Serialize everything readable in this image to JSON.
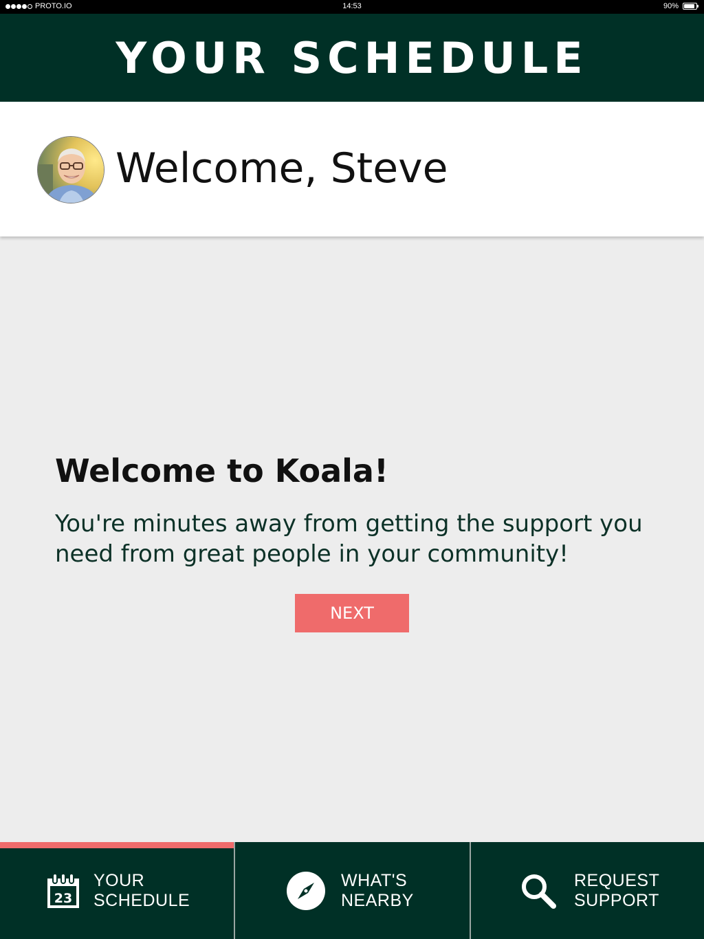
{
  "status_bar": {
    "carrier": "PROTO.IO",
    "time": "14:53",
    "battery_percent_text": "90%",
    "battery_level": 0.9
  },
  "header": {
    "title": "YOUR SCHEDULE"
  },
  "welcome": {
    "greeting": "Welcome, Steve"
  },
  "onboarding": {
    "heading": "Welcome to Koala!",
    "body": "You're minutes away from getting the support you need from great people in your community!",
    "next_label": "NEXT"
  },
  "tabs": [
    {
      "line1": "YOUR",
      "line2": "SCHEDULE",
      "icon": "calendar-icon",
      "calendar_day": "23",
      "active": true
    },
    {
      "line1": "WHAT'S",
      "line2": "NEARBY",
      "icon": "compass-icon",
      "active": false
    },
    {
      "line1": "REQUEST",
      "line2": "SUPPORT",
      "icon": "search-icon",
      "active": false
    }
  ],
  "colors": {
    "primary": "#003026",
    "accent": "#ef6b6b",
    "background": "#ededed"
  }
}
